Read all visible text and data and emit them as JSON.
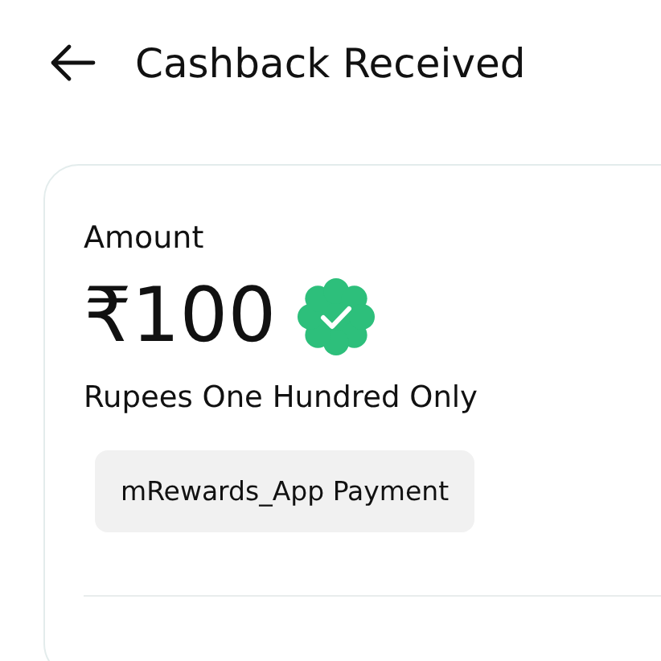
{
  "header": {
    "title": "Cashback Received"
  },
  "card": {
    "label": "Amount",
    "amount": "₹100",
    "amount_words": "Rupees One Hundred Only",
    "tag": "mRewards_App Payment"
  }
}
